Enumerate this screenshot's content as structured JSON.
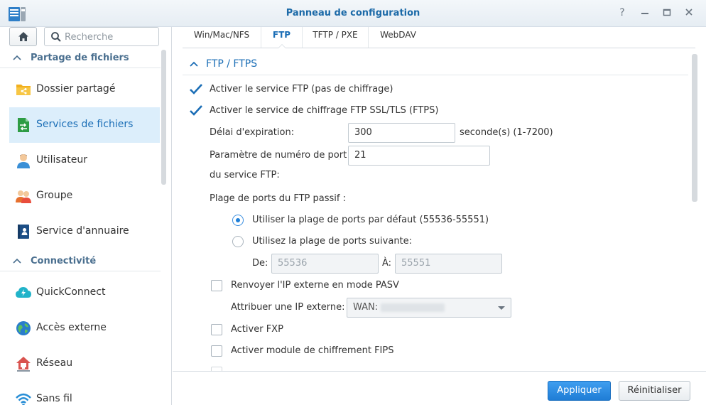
{
  "window": {
    "title": "Panneau de configuration"
  },
  "sidebar": {
    "search": {
      "placeholder": "Recherche",
      "value": ""
    },
    "sections": [
      {
        "label": "Partage de fichiers"
      },
      {
        "label": "Connectivité"
      }
    ],
    "items": [
      {
        "label": "Dossier partagé",
        "icon": "shared-folder-icon"
      },
      {
        "label": "Services de fichiers",
        "icon": "file-services-icon",
        "active": true
      },
      {
        "label": "Utilisateur",
        "icon": "user-icon"
      },
      {
        "label": "Groupe",
        "icon": "group-icon"
      },
      {
        "label": "Service d'annuaire",
        "icon": "directory-service-icon"
      },
      {
        "label": "QuickConnect",
        "icon": "quickconnect-icon"
      },
      {
        "label": "Accès externe",
        "icon": "external-access-icon"
      },
      {
        "label": "Réseau",
        "icon": "network-icon"
      },
      {
        "label": "Sans fil",
        "icon": "wireless-icon"
      }
    ]
  },
  "tabs": [
    {
      "label": "Win/Mac/NFS"
    },
    {
      "label": "FTP",
      "active": true
    },
    {
      "label": "TFTP / PXE"
    },
    {
      "label": "WebDAV"
    }
  ],
  "ftp": {
    "section_title": "FTP / FTPS",
    "enable_ftp": {
      "label": "Activer le service FTP (pas de chiffrage)",
      "checked": true
    },
    "enable_ftps": {
      "label": "Activer le service de chiffrage FTP SSL/TLS (FTPS)",
      "checked": true
    },
    "timeout": {
      "label": "Délai d'expiration:",
      "value": "300",
      "suffix": "seconde(s) (1-7200)"
    },
    "port": {
      "label_line1": "Paramètre de numéro de port",
      "label_line2": "du service FTP:",
      "value": "21"
    },
    "passive_range": {
      "label": "Plage de ports du FTP passif :",
      "default_option": {
        "label": "Utiliser la plage de ports par défaut (55536-55551)",
        "selected": true
      },
      "custom_option": {
        "label": "Utilisez la plage de ports suivante:",
        "selected": false
      },
      "from_label": "De:",
      "from_value": "55536",
      "to_label": "À:",
      "to_value": "55551"
    },
    "pasv_external_ip": {
      "label": "Renvoyer l'IP externe en mode PASV",
      "checked": false
    },
    "assign_external_ip": {
      "label": "Attribuer une IP externe:",
      "value": "WAN:"
    },
    "enable_fxp": {
      "label": "Activer FXP",
      "checked": false
    },
    "enable_fips": {
      "label": "Activer module de chiffrement FIPS",
      "checked": false
    }
  },
  "footer": {
    "apply": "Appliquer",
    "reset": "Réinitialiser"
  },
  "colors": {
    "accent": "#1b6eb6",
    "active_bg": "#dceefb",
    "primary_button": "#2a8ae3"
  }
}
